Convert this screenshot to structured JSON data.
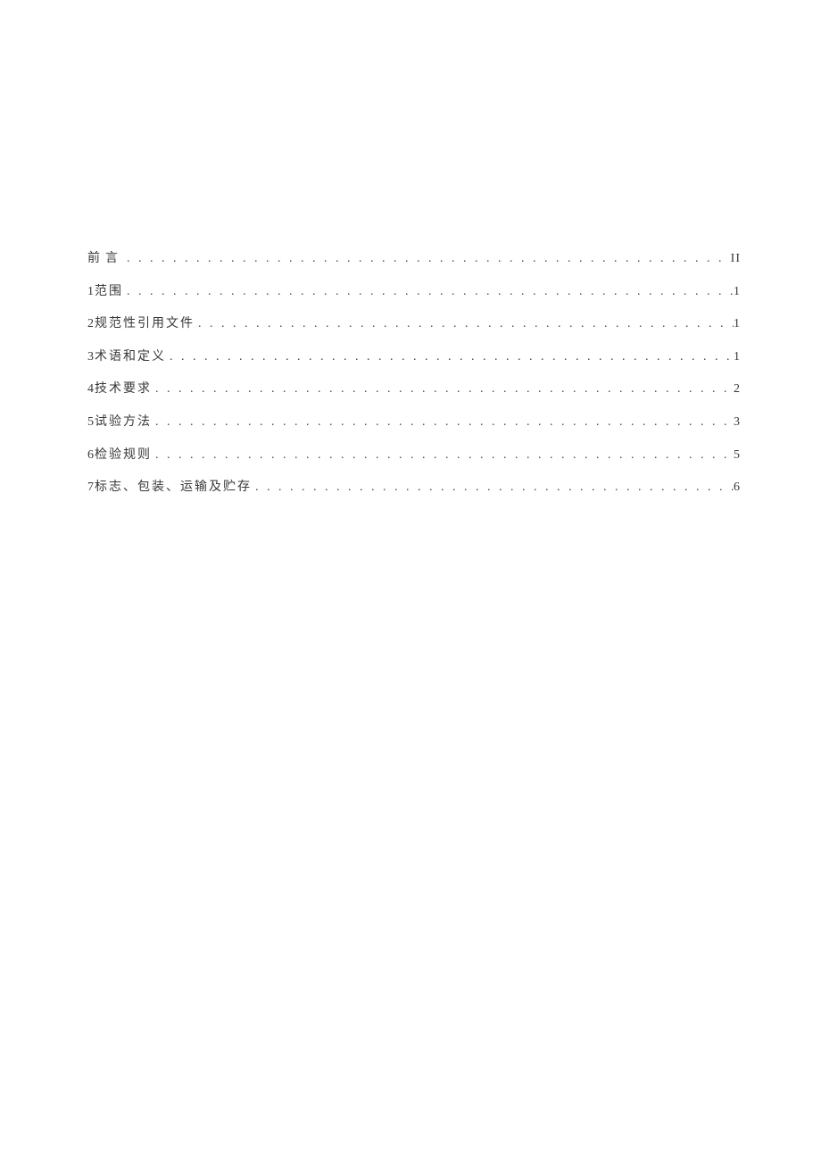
{
  "toc": {
    "entries": [
      {
        "num": "",
        "title": "前言",
        "page": "II",
        "foreword": true
      },
      {
        "num": "1",
        "title": "范围",
        "page": "1",
        "foreword": false
      },
      {
        "num": "2",
        "title": "规范性引用文件",
        "page": "1",
        "foreword": false
      },
      {
        "num": "3",
        "title": "术语和定义",
        "page": "1",
        "foreword": false
      },
      {
        "num": "4",
        "title": "技术要求",
        "page": "2",
        "foreword": false
      },
      {
        "num": "5",
        "title": "试验方法",
        "page": "3",
        "foreword": false
      },
      {
        "num": "6",
        "title": "检验规则",
        "page": "5",
        "foreword": false
      },
      {
        "num": "7",
        "title": "标志、包装、运输及贮存",
        "page": "6",
        "foreword": false
      }
    ]
  },
  "dots": ". . . . . . . . . . . . . . . . . . . . . . . . . . . . . . . . . . . . . . . . . . . . . . . . . . . . . . . . . . . . . . . . . . . . . . . . . . . . . . . . . . . . . . . . . . . . . . . . . . . . . . . . . . . . . . . . . . . . . . . . . . . . . . . . . . . . . . . . . . . . . . . . . . . . . . . . . . . . . . . . . . . . . . . . . . . . . . . . . . . . . . . . . . . . . . . . . . . ."
}
